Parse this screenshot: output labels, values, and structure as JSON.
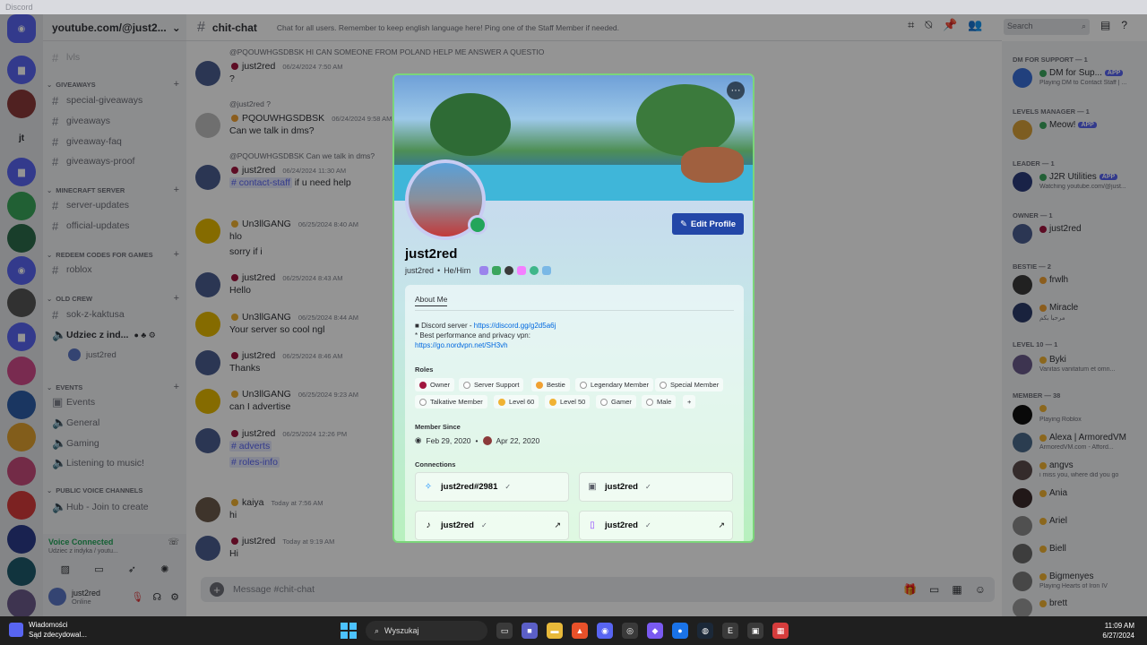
{
  "window": {
    "title": "Discord"
  },
  "guild": {
    "name": "youtube.com/@just2..."
  },
  "sidebar": {
    "truncated_top": "lvls",
    "categories": [
      {
        "name": "GIVEAWAYS",
        "channels": [
          "special-giveaways",
          "giveaways",
          "giveaway-faq",
          "giveaways-proof"
        ]
      },
      {
        "name": "MINECRAFT SERVER",
        "channels": [
          "server-updates",
          "official-updates"
        ]
      },
      {
        "name": "REDEEM CODES FOR GAMES",
        "channels": [
          "roblox"
        ]
      },
      {
        "name": "OLD CREW",
        "channels": [
          "sok-z-kaktusa",
          "Udziec z ind..."
        ]
      },
      {
        "name": "EVENTS",
        "channels": [
          "Events",
          "General",
          "Gaming",
          "Listening to music!"
        ]
      },
      {
        "name": "PUBLIC VOICE CHANNELS",
        "channels": [
          "Hub - Join to create"
        ]
      }
    ],
    "voice_user": "just2red"
  },
  "user_panel": {
    "voice_status": "Voice Connected",
    "voice_channel": "Udziec z indyka / youtu...",
    "username": "just2red",
    "status": "Online"
  },
  "chat": {
    "channel": "chit-chat",
    "topic": "Chat for all users. Remember to keep english language here! Ping one of the Staff Member if needed.",
    "search_placeholder": "Search",
    "composer_placeholder": "Message #chit-chat",
    "messages": [
      {
        "reply": "@PQOUWHGSDBSK HI CAN SOMEONE FROM POLAND HELP ME ANSWER A QUESTIO",
        "author": "just2red",
        "time": "06/24/2024 7:50 AM",
        "lines": [
          "?"
        ]
      },
      {
        "reply": "@just2red ?",
        "author": "PQOUWHGSDBSK",
        "time": "06/24/2024 9:58 AM",
        "lines": [
          "Can we talk in dms?"
        ]
      },
      {
        "reply": "@PQOUWHGSDBSK Can we talk in dms?",
        "author": "just2red",
        "time": "06/24/2024 11:30 AM",
        "mention": "# contact-staff",
        "lines": [
          "if u need help"
        ]
      },
      {
        "author": "Un3llGANG",
        "time": "06/25/2024 8:40 AM",
        "lines": [
          "hlo",
          "sorry if i"
        ]
      },
      {
        "author": "just2red",
        "time": "06/25/2024 8:43 AM",
        "lines": [
          "Hello"
        ]
      },
      {
        "author": "Un3llGANG",
        "time": "06/25/2024 8:44 AM",
        "lines": [
          "Your server so cool ngl"
        ]
      },
      {
        "author": "just2red",
        "time": "06/25/2024 8:46 AM",
        "lines": [
          "Thanks"
        ]
      },
      {
        "author": "Un3llGANG",
        "time": "06/25/2024 9:23 AM",
        "lines": [
          "can I advertise"
        ]
      },
      {
        "author": "just2red",
        "time": "06/25/2024 12:26 PM",
        "lines": [
          "# adverts",
          "# roles-info"
        ]
      },
      {
        "author": "kaiya",
        "time": "Today at 7:56 AM",
        "lines": [
          "hi"
        ]
      },
      {
        "author": "just2red",
        "time": "Today at 9:19 AM",
        "lines": [
          "Hi"
        ]
      }
    ]
  },
  "members": {
    "groups": [
      {
        "name": "DM FOR SUPPORT — 1",
        "items": [
          {
            "name": "DM for Sup...",
            "badge": "APP",
            "sub": "Playing DM to Contact Staff | ..."
          }
        ]
      },
      {
        "name": "LEVELS MANAGER — 1",
        "items": [
          {
            "name": "Meow!",
            "badge": "APP",
            "sub": ""
          }
        ]
      },
      {
        "name": "LEADER — 1",
        "items": [
          {
            "name": "J2R Utilities",
            "badge": "APP",
            "sub": "Watching youtube.com/@just..."
          }
        ]
      },
      {
        "name": "OWNER — 1",
        "items": [
          {
            "name": "just2red",
            "badge": "",
            "sub": ""
          }
        ]
      },
      {
        "name": "BESTIE — 2",
        "items": [
          {
            "name": "frwlh",
            "badge": "",
            "sub": ""
          },
          {
            "name": "Miracle",
            "badge": "",
            "sub": "مرحبا بكم"
          }
        ]
      },
      {
        "name": "LEVEL 10 — 1",
        "items": [
          {
            "name": "Byki",
            "badge": "",
            "sub": "Vanitas vanitatum et omn..."
          }
        ]
      },
      {
        "name": "MEMBER — 38",
        "items": [
          {
            "name": "",
            "badge": "",
            "sub": "Playing Roblox"
          },
          {
            "name": "Alexa | ArmoredVM",
            "badge": "",
            "sub": "ArmoredVM.com - Afford..."
          },
          {
            "name": "angvs",
            "badge": "",
            "sub": "i miss you, where did you go"
          },
          {
            "name": "Ania",
            "badge": "",
            "sub": ""
          },
          {
            "name": "Ariel",
            "badge": "",
            "sub": ""
          },
          {
            "name": "Biell",
            "badge": "",
            "sub": ""
          },
          {
            "name": "Bigmenyes",
            "badge": "",
            "sub": "Playing Hearts of Iron IV"
          },
          {
            "name": "brett",
            "badge": "",
            "sub": ""
          }
        ]
      }
    ]
  },
  "profile": {
    "display_name": "just2red",
    "username": "just2red",
    "pronouns": "He/Him",
    "edit_label": "Edit Profile",
    "tab": "About Me",
    "about_line1": "Discord server - ",
    "about_link1": "https://discord.gg/g2d5a6j",
    "about_line2": "* Best performance and privacy vpn:",
    "about_link2": "https://go.nordvpn.net/SH3vh",
    "roles_label": "Roles",
    "roles": [
      {
        "name": "Owner",
        "color": "#a0153e"
      },
      {
        "name": "Server Support",
        "color": "#cfd2d8"
      },
      {
        "name": "Bestie",
        "color": "#f0a132"
      },
      {
        "name": "Legendary Member",
        "color": "#cfd2d8"
      },
      {
        "name": "Special Member",
        "color": "#cfd2d8"
      },
      {
        "name": "Talkative Member",
        "color": "#cfd2d8"
      },
      {
        "name": "Level 60",
        "color": "#f0b232"
      },
      {
        "name": "Level 50",
        "color": "#f0b232"
      },
      {
        "name": "Gamer",
        "color": "#cfd2d8"
      },
      {
        "name": "Male",
        "color": "#cfd2d8"
      }
    ],
    "add_role": "+",
    "member_since_label": "Member Since",
    "discord_since": "Feb 29, 2020",
    "server_since": "Apr 22, 2020",
    "connections_label": "Connections",
    "connections": [
      {
        "name": "just2red#2981",
        "icon": "battlenet-icon"
      },
      {
        "name": "just2red",
        "icon": "epic-icon"
      },
      {
        "name": "just2red",
        "icon": "tiktok-icon"
      },
      {
        "name": "just2red",
        "icon": "twitch-icon"
      }
    ]
  },
  "taskbar": {
    "notif_title": "Wiadomości",
    "notif_text": "Sąd zdecydowal...",
    "search": "Wyszukaj",
    "time": "11:09 AM",
    "date": "6/27/2024"
  },
  "colors": {
    "accent": "#5865f2",
    "online": "#23a55a",
    "owner_role": "#a0153e",
    "edit_button": "#2347a8"
  }
}
